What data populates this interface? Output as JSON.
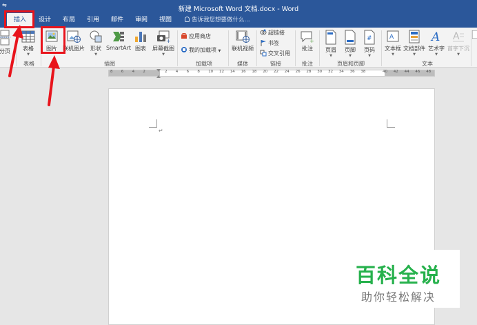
{
  "window": {
    "quick_access": "⇋",
    "title": "新建 Microsoft Word 文档.docx - Word"
  },
  "tabs": [
    {
      "label": "插入",
      "active": true
    },
    {
      "label": "设计"
    },
    {
      "label": "布局"
    },
    {
      "label": "引用"
    },
    {
      "label": "邮件"
    },
    {
      "label": "审阅"
    },
    {
      "label": "视图"
    }
  ],
  "tell_me": {
    "placeholder": "告诉我您想要做什么..."
  },
  "ribbon": {
    "pages": {
      "page_break": "分页",
      "group": ""
    },
    "tables": {
      "table": "表格",
      "group": "表格"
    },
    "illustrations": {
      "picture": "图片",
      "online_picture": "联机图片",
      "shapes": "形状",
      "smartart": "SmartArt",
      "chart": "图表",
      "screenshot": "屏幕截图",
      "group": "插图"
    },
    "addins": {
      "store": "应用商店",
      "my_addins": "我的加载项",
      "group": "加载项"
    },
    "media": {
      "online_video": "联机视频",
      "group": "媒体"
    },
    "links": {
      "hyperlink": "超链接",
      "bookmark": "书签",
      "cross_reference": "交叉引用",
      "group": "链接"
    },
    "comments": {
      "comment": "批注",
      "group": "批注"
    },
    "header_footer": {
      "header": "页眉",
      "footer": "页脚",
      "page_number": "页码",
      "group": "页眉和页脚"
    },
    "text": {
      "textbox": "文本框",
      "quick_parts": "文档部件",
      "wordart": "艺术字",
      "dropcap": "首字下沉",
      "group": "文本"
    }
  },
  "ruler": {
    "numbers": [
      "8",
      "6",
      "4",
      "2",
      "",
      "2",
      "4",
      "6",
      "8",
      "10",
      "12",
      "14",
      "16",
      "18",
      "20",
      "22",
      "24",
      "26",
      "28",
      "30",
      "32",
      "34",
      "36",
      "38",
      "",
      "40",
      "42",
      "44",
      "46",
      "48"
    ]
  },
  "document": {
    "paragraph_mark": "↵"
  },
  "watermark": {
    "main": "百科全说",
    "sub": "助你轻松解决"
  },
  "colors": {
    "title_bar": "#2b579a",
    "ribbon": "#f3f3f3",
    "highlight": "#e8141c",
    "watermark_green": "#26b14c"
  }
}
